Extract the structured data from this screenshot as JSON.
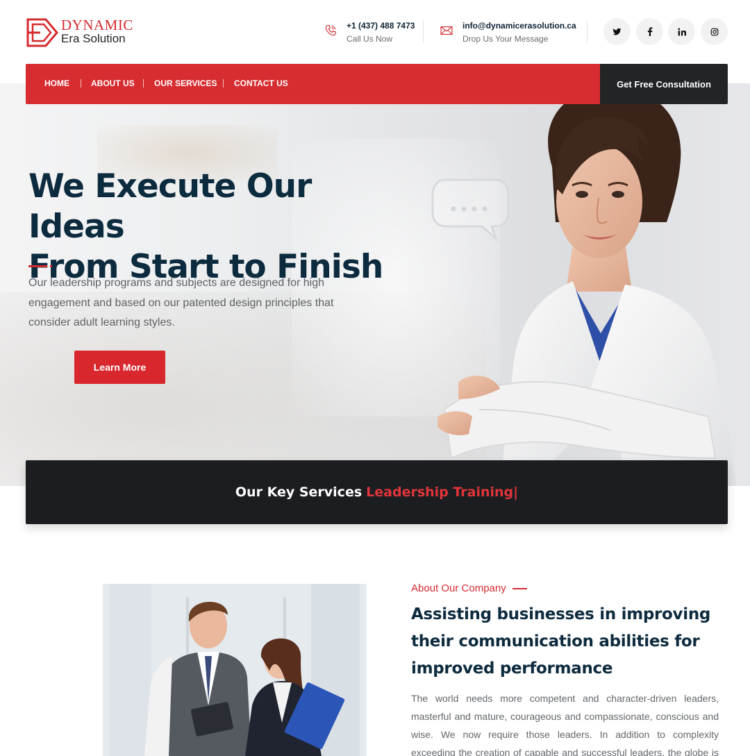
{
  "brand": {
    "line1": "DYNAMIC",
    "line2": "Era Solution",
    "accent": "#d72d31",
    "dark": "#0d2b3e"
  },
  "header": {
    "phone": {
      "value": "+1 (437) 488 7473",
      "caption": "Call Us Now",
      "icon": "phone-icon"
    },
    "email": {
      "value": "info@dynamicerasolution.ca",
      "caption": "Drop Us Your Message",
      "icon": "mail-icon"
    },
    "social": [
      "twitter-icon",
      "facebook-icon",
      "linkedin-icon",
      "instagram-icon"
    ]
  },
  "nav": {
    "items": [
      "HOME",
      "ABOUT US",
      "OUR SERVICES",
      "CONTACT US"
    ],
    "cta": "Get Free Consultation"
  },
  "hero": {
    "title_line1": "We Execute Our Ideas",
    "title_line2": "From Start to Finish",
    "text": "Our leadership programs and subjects are designed for high engagement and based on our patented design principles that consider adult learning styles.",
    "button": "Learn More"
  },
  "key_services": {
    "lead": "Our Key Services",
    "highlight": "Leadership Training",
    "cursor": "|"
  },
  "about": {
    "eyebrow": "About Our Company",
    "title": "Assisting businesses in improving their communication abilities for improved performance",
    "text": "The world needs more competent and character-driven leaders, masterful and mature, courageous and compassionate, conscious and wise. We now require those leaders. In addition to complexity exceeding the creation of capable and successful leaders, the globe is currently"
  }
}
